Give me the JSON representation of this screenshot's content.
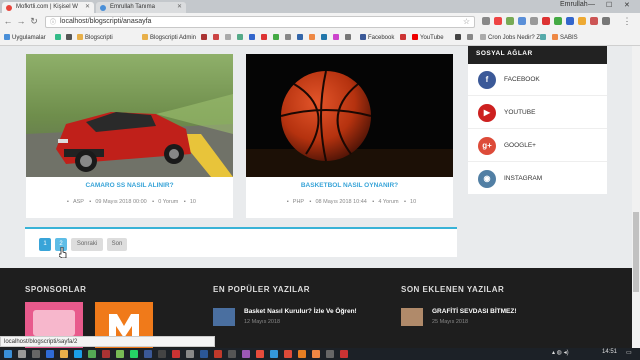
{
  "browser": {
    "tabs": [
      {
        "title": "Mofkrtli.com | Kişisel W"
      },
      {
        "title": "Emrullah Tanıma"
      }
    ],
    "user": "Emrullah",
    "url": "localhost/blogscripti/anasayfa",
    "bookmarks": [
      "Uygulamalar",
      "Blogscripti",
      "Blogscripti Admin",
      "Facebook",
      "YouTube",
      "Cron Jobs Nedir? Za",
      "SABIS"
    ]
  },
  "posts": [
    {
      "title": "CAMARO SS NASIL ALINIR?",
      "category": "ASP",
      "date": "09 Mayıs 2018 00:00",
      "comments": "0 Yorum",
      "views": "10"
    },
    {
      "title": "BASKETBOL NASIL OYNANIR?",
      "category": "PHP",
      "date": "08 Mayıs 2018 10:44",
      "comments": "4 Yorum",
      "views": "10"
    }
  ],
  "pagination": {
    "pages": [
      "1",
      "2"
    ],
    "next": "Sonraki",
    "last": "Son"
  },
  "sidebar": {
    "title": "SOSYAL AĞLAR",
    "items": [
      {
        "label": "FACEBOOK",
        "glyph": "f",
        "color": "#3b5998"
      },
      {
        "label": "YOUTUBE",
        "glyph": "▶",
        "color": "#cd201f"
      },
      {
        "label": "GOOGLE+",
        "glyph": "g+",
        "color": "#dd4b39"
      },
      {
        "label": "INSTAGRAM",
        "glyph": "◉",
        "color": "#517fa4"
      }
    ]
  },
  "footer": {
    "sponsors_title": "SPONSORLAR",
    "popular_title": "EN POPÜLER YAZILAR",
    "recent_title": "SON EKLENEN YAZILAR",
    "popular": [
      {
        "title": "Basket Nasıl Kurulur? İzle Ve Öğren!",
        "date": "12 Mayıs 2018"
      }
    ],
    "recent": [
      {
        "title": "GRAFİTİ SEVDASI BİTMEZ!",
        "date": "25 Mayıs 2018"
      }
    ]
  },
  "status_url": "localhost/blogscripti/sayfa/2",
  "clock": "14:51"
}
